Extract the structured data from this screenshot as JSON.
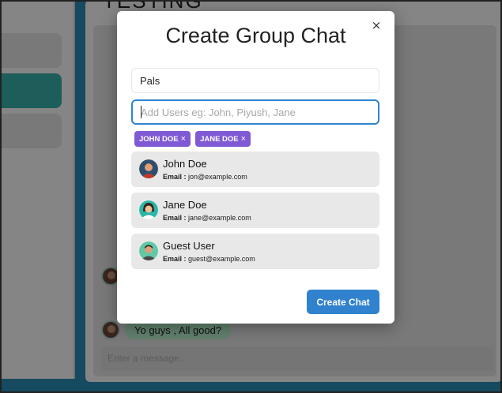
{
  "modal": {
    "title": "Create Group Chat",
    "close_symbol": "×",
    "chat_name_value": "Pals",
    "users_placeholder": "Add Users eg: John, Piyush, Jane",
    "selected_users": [
      {
        "label": "JOHN DOE",
        "remove_symbol": "×"
      },
      {
        "label": "JANE DOE",
        "remove_symbol": "×"
      }
    ],
    "search_results": [
      {
        "name": "John Doe",
        "email_label": "Email :",
        "email": "jon@example.com",
        "avatar_icon": "man-avatar-icon"
      },
      {
        "name": "Jane Doe",
        "email_label": "Email :",
        "email": "jane@example.com",
        "avatar_icon": "woman-avatar-icon"
      },
      {
        "name": "Guest User",
        "email_label": "Email :",
        "email": "guest@example.com",
        "avatar_icon": "guest-avatar-icon"
      }
    ],
    "create_button_label": "Create Chat"
  },
  "background": {
    "chat_title": "TESTING",
    "message": "Yo guys , All good?",
    "message_input_placeholder": "Enter a message.."
  },
  "colors": {
    "tag": "#805ad5",
    "primary_button": "#3182ce",
    "bubble": "#b9f5d0",
    "active_item": "#38b2ac"
  }
}
